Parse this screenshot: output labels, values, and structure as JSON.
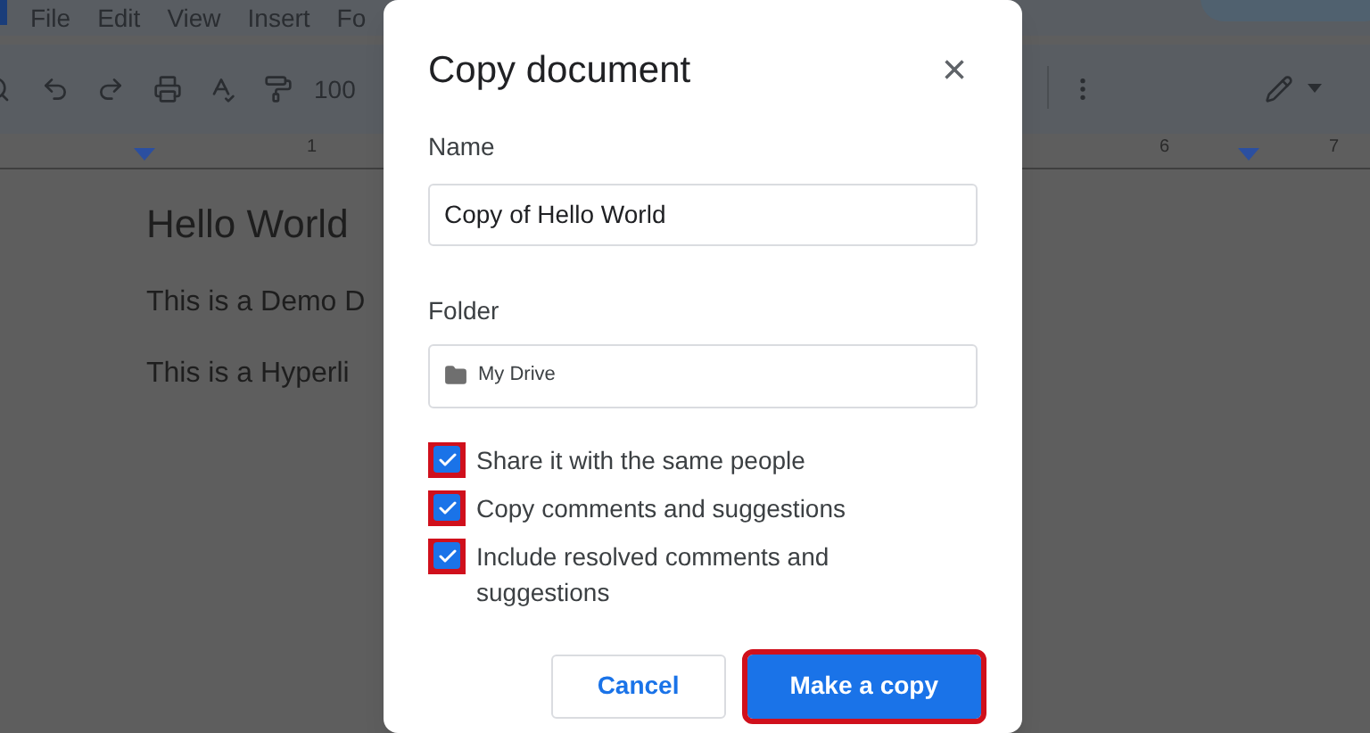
{
  "menu_bar": [
    "File",
    "Edit",
    "View",
    "Insert",
    "Fo"
  ],
  "toolbar": {
    "zoom": "100"
  },
  "ruler": {
    "labels": [
      "1",
      "6",
      "7"
    ]
  },
  "document": {
    "heading": "Hello World",
    "paragraphs": [
      "This is a Demo D",
      "This is a Hyperli"
    ]
  },
  "dialog": {
    "title": "Copy document",
    "close": "×",
    "name_label": "Name",
    "name_value": "Copy of Hello World",
    "folder_label": "Folder",
    "folder_value": "My Drive",
    "options": [
      {
        "label": "Share it with the same people",
        "checked": true,
        "highlighted": true
      },
      {
        "label": "Copy comments and suggestions",
        "checked": true,
        "highlighted": true
      },
      {
        "label": "Include resolved comments and suggestions",
        "checked": true,
        "highlighted": true
      }
    ],
    "buttons": [
      {
        "label": "Cancel",
        "kind": "secondary",
        "highlighted": false
      },
      {
        "label": "Make a copy",
        "kind": "primary",
        "highlighted": true
      }
    ]
  }
}
